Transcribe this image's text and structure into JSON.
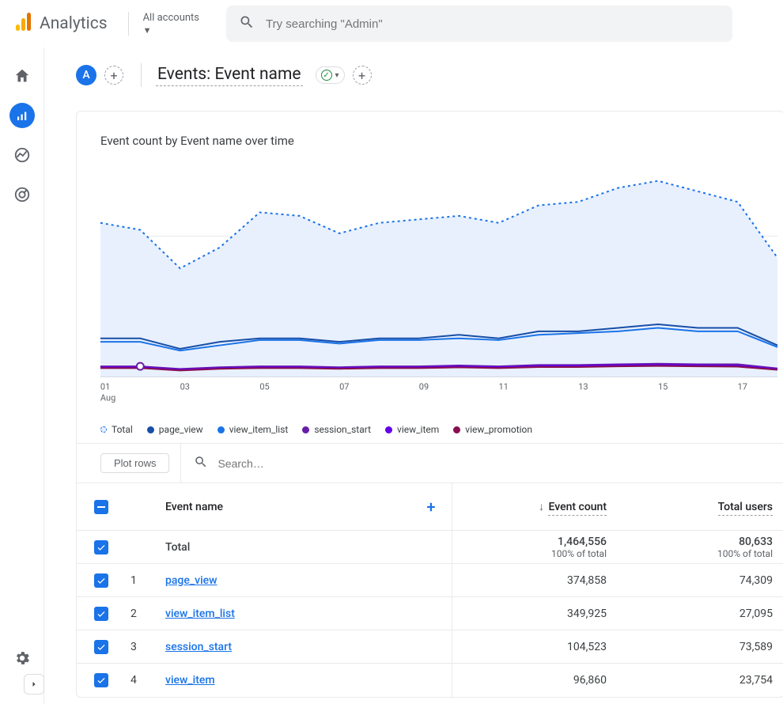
{
  "header": {
    "brand": "Analytics",
    "accounts_label": "All accounts",
    "search_placeholder": "Try searching \"Admin\""
  },
  "report": {
    "avatar_letter": "A",
    "title": "Events: Event name",
    "card_title": "Event count by Event name over time",
    "xaxis_month": "Aug"
  },
  "legend": {
    "total": "Total",
    "page_view": "page_view",
    "view_item_list": "view_item_list",
    "session_start": "session_start",
    "view_item": "view_item",
    "view_promotion": "view_promotion"
  },
  "toolbar": {
    "plot_rows": "Plot rows",
    "search_placeholder": "Search…"
  },
  "table": {
    "headers": {
      "event_name": "Event name",
      "event_count": "Event count",
      "total_users": "Total users"
    },
    "total_label": "Total",
    "total_event_count": "1,464,556",
    "total_users": "80,633",
    "pct_total": "100% of total",
    "rows": [
      {
        "i": "1",
        "name": "page_view",
        "event_count": "374,858",
        "total_users": "74,309"
      },
      {
        "i": "2",
        "name": "view_item_list",
        "event_count": "349,925",
        "total_users": "27,095"
      },
      {
        "i": "3",
        "name": "session_start",
        "event_count": "104,523",
        "total_users": "73,589"
      },
      {
        "i": "4",
        "name": "view_item",
        "event_count": "96,860",
        "total_users": "23,754"
      }
    ]
  },
  "colors": {
    "total": "#1a73e8",
    "page_view": "#174ea6",
    "view_item_list": "#1a73e8",
    "session_start": "#681da8",
    "view_item": "#6200ea",
    "view_promotion": "#880e4f"
  },
  "chart_data": {
    "type": "line",
    "title": "Event count by Event name over time",
    "xlabel": "Aug",
    "ylabel": "",
    "x": [
      "01",
      "02",
      "03",
      "04",
      "05",
      "06",
      "07",
      "08",
      "09",
      "10",
      "11",
      "12",
      "13",
      "14",
      "15",
      "16",
      "17",
      "18"
    ],
    "x_ticks_shown": [
      "01",
      "03",
      "05",
      "07",
      "09",
      "11",
      "13",
      "15",
      "17"
    ],
    "ylim": [
      0,
      120000
    ],
    "series": [
      {
        "name": "Total",
        "style": "dashed-area",
        "values": [
          88000,
          84000,
          62000,
          74000,
          94000,
          92000,
          82000,
          88000,
          90000,
          92000,
          88000,
          98000,
          100000,
          108000,
          112000,
          106000,
          100000,
          68000
        ]
      },
      {
        "name": "page_view",
        "values": [
          22000,
          22000,
          16000,
          20000,
          22000,
          22000,
          20000,
          22000,
          22000,
          24000,
          22000,
          26000,
          26000,
          28000,
          30000,
          28000,
          28000,
          18000
        ]
      },
      {
        "name": "view_item_list",
        "values": [
          20000,
          20000,
          15000,
          18000,
          21000,
          21000,
          19000,
          21000,
          21000,
          22000,
          21000,
          24000,
          25000,
          26000,
          28000,
          26000,
          26000,
          17000
        ]
      },
      {
        "name": "session_start",
        "values": [
          6000,
          6000,
          4500,
          5500,
          6000,
          6000,
          5500,
          6000,
          6000,
          6500,
          6000,
          6800,
          6800,
          7200,
          7500,
          7200,
          7200,
          4800
        ]
      },
      {
        "name": "view_item",
        "values": [
          5500,
          5500,
          4000,
          5000,
          5500,
          5500,
          5000,
          5500,
          5500,
          6000,
          5500,
          6200,
          6200,
          6600,
          6800,
          6600,
          6400,
          4400
        ]
      },
      {
        "name": "view_promotion",
        "values": [
          5000,
          5000,
          3600,
          4600,
          5000,
          5000,
          4600,
          5000,
          5000,
          5400,
          5000,
          5600,
          5600,
          6000,
          6200,
          6000,
          5800,
          4000
        ]
      }
    ],
    "marker": {
      "x": "02",
      "series": "session_start"
    }
  }
}
